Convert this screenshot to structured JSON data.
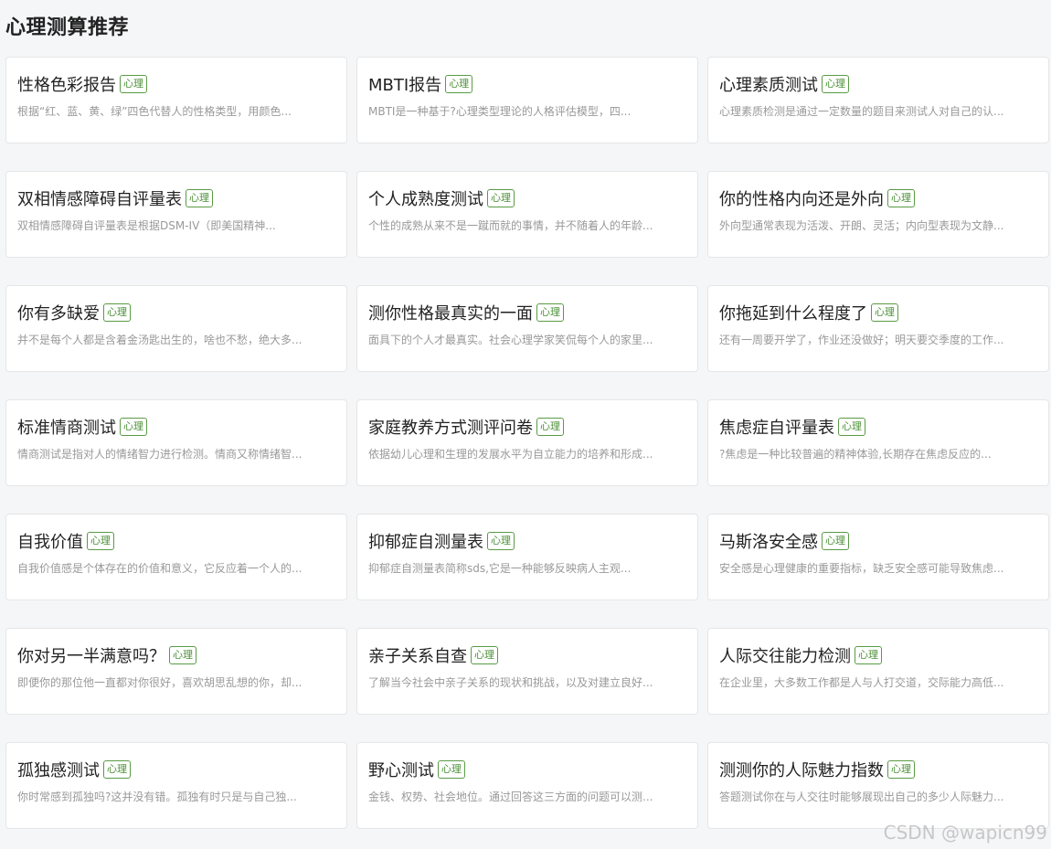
{
  "page": {
    "title": "心理测算推荐",
    "watermark": "CSDN @wapicn99"
  },
  "colors": {
    "background": "#f5f6f8",
    "tag_green": "#4a8f36"
  },
  "cards": [
    {
      "title": "性格色彩报告",
      "tag": "心理",
      "desc": "根据“红、蓝、黄、绿”四色代替人的性格类型，用颜色..."
    },
    {
      "title": "MBTI报告",
      "tag": "心理",
      "desc": "MBTI是一种基于?心理类型理论的人格评估模型，四..."
    },
    {
      "title": "心理素质测试",
      "tag": "心理",
      "desc": "心理素质检测是通过一定数量的题目来测试人对自己的认..."
    },
    {
      "title": "双相情感障碍自评量表",
      "tag": "心理",
      "desc": "双相情感障碍自评量表是根据DSM-IV（即美国精神..."
    },
    {
      "title": "个人成熟度测试",
      "tag": "心理",
      "desc": "个性的成熟从来不是一蹴而就的事情，并不随着人的年龄..."
    },
    {
      "title": "你的性格内向还是外向",
      "tag": "心理",
      "desc": "外向型通常表现为活泼、开朗、灵活；内向型表现为文静..."
    },
    {
      "title": "你有多缺爱",
      "tag": "心理",
      "desc": "并不是每个人都是含着金汤匙出生的，啥也不愁，绝大多..."
    },
    {
      "title": "测你性格最真实的一面",
      "tag": "心理",
      "desc": "面具下的个人才最真实。社会心理学家笑侃每个人的家里..."
    },
    {
      "title": "你拖延到什么程度了",
      "tag": "心理",
      "desc": "还有一周要开学了，作业还没做好；明天要交季度的工作..."
    },
    {
      "title": "标准情商测试",
      "tag": "心理",
      "desc": "情商测试是指对人的情绪智力进行检测。情商又称情绪智..."
    },
    {
      "title": "家庭教养方式测评问卷",
      "tag": "心理",
      "desc": "依据幼儿心理和生理的发展水平为自立能力的培养和形成..."
    },
    {
      "title": "焦虑症自评量表",
      "tag": "心理",
      "desc": "?焦虑是一种比较普遍的精神体验,长期存在焦虑反应的..."
    },
    {
      "title": "自我价值",
      "tag": "心理",
      "desc": "自我价值感是个体存在的价值和意义，它反应着一个人的..."
    },
    {
      "title": "抑郁症自测量表",
      "tag": "心理",
      "desc": "抑郁症自测量表简称sds,它是一种能够反映病人主观..."
    },
    {
      "title": "马斯洛安全感",
      "tag": "心理",
      "desc": "安全感是心理健康的重要指标，缺乏安全感可能导致焦虑..."
    },
    {
      "title": "你对另一半满意吗？",
      "tag": "心理",
      "desc": "即便你的那位他一直都对你很好，喜欢胡思乱想的你，却..."
    },
    {
      "title": "亲子关系自查",
      "tag": "心理",
      "desc": "了解当今社会中亲子关系的现状和挑战，以及对建立良好..."
    },
    {
      "title": "人际交往能力检测",
      "tag": "心理",
      "desc": "在企业里，大多数工作都是人与人打交道，交际能力高低..."
    },
    {
      "title": "孤独感测试",
      "tag": "心理",
      "desc": "你时常感到孤独吗?这并没有错。孤独有时只是与自己独..."
    },
    {
      "title": "野心测试",
      "tag": "心理",
      "desc": "金钱、权势、社会地位。通过回答这三方面的问题可以测..."
    },
    {
      "title": "测测你的人际魅力指数",
      "tag": "心理",
      "desc": "答题测试你在与人交往时能够展现出自己的多少人际魅力..."
    }
  ]
}
